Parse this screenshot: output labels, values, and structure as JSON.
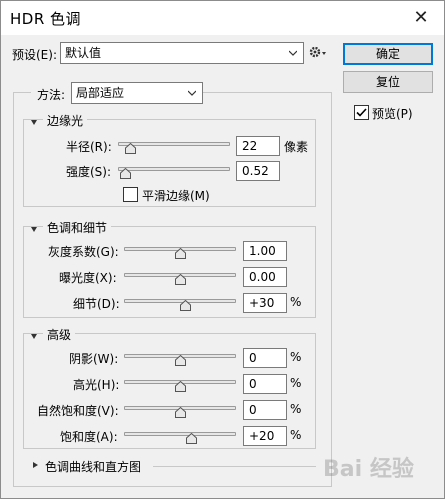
{
  "window": {
    "title": "HDR 色调",
    "close_glyph": "✕"
  },
  "preset": {
    "label": "预设(E):",
    "value": "默认值"
  },
  "buttons": {
    "ok": "确定",
    "reset": "复位"
  },
  "preview": {
    "label": "预览(P)",
    "checked": true
  },
  "method": {
    "label": "方法:",
    "value": "局部适应"
  },
  "edge_glow": {
    "title": "边缘光",
    "radius": {
      "label": "半径(R):",
      "value": "22",
      "unit": "像素",
      "slider": 0.11
    },
    "strength": {
      "label": "强度(S):",
      "value": "0.52",
      "unit": "",
      "slider": 0.07
    },
    "smooth_edges": {
      "label": "平滑边缘(M)",
      "checked": false
    }
  },
  "tone_detail": {
    "title": "色调和细节",
    "gamma": {
      "label": "灰度系数(G):",
      "value": "1.00",
      "unit": "",
      "slider": 0.5
    },
    "exposure": {
      "label": "曝光度(X):",
      "value": "0.00",
      "unit": "",
      "slider": 0.5
    },
    "detail": {
      "label": "细节(D):",
      "value": "+30",
      "unit": "%",
      "slider": 0.55
    }
  },
  "advanced": {
    "title": "高级",
    "shadow": {
      "label": "阴影(W):",
      "value": "0",
      "unit": "%",
      "slider": 0.5
    },
    "highlight": {
      "label": "高光(H):",
      "value": "0",
      "unit": "%",
      "slider": 0.5
    },
    "vibrance": {
      "label": "自然饱和度(V):",
      "value": "0",
      "unit": "%",
      "slider": 0.5
    },
    "saturation": {
      "label": "饱和度(A):",
      "value": "+20",
      "unit": "%",
      "slider": 0.6
    }
  },
  "toning_curve": {
    "title": "色调曲线和直方图"
  },
  "watermark": {
    "text": "Bai 经验"
  }
}
